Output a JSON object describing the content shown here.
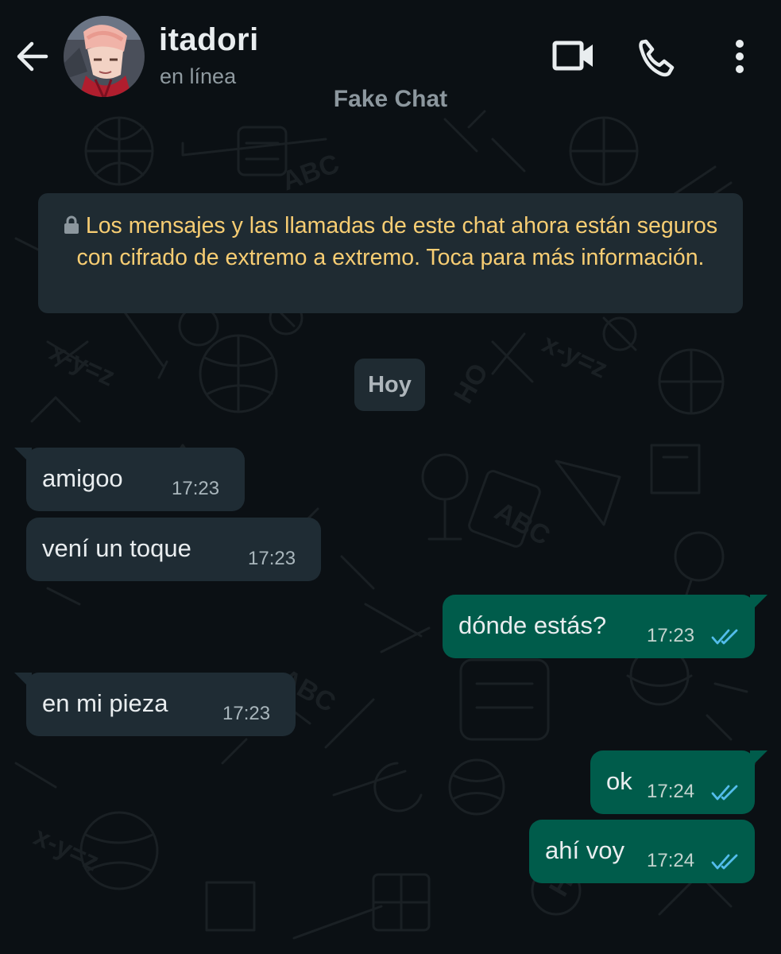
{
  "header": {
    "contact_name": "itadori",
    "status": "en línea",
    "watermark": "Fake Chat",
    "icons": {
      "back": "arrow-left-icon",
      "video": "video-camera-icon",
      "call": "phone-icon",
      "menu": "more-vertical-icon"
    }
  },
  "encryption_notice": {
    "text": "Los mensajes y las llamadas de este chat ahora están seguros con cifrado de extremo a extremo. Toca para más información.",
    "icon": "lock-icon"
  },
  "date_divider": "Hoy",
  "messages": [
    {
      "direction": "incoming",
      "text": "amigoo",
      "time": "17:23"
    },
    {
      "direction": "incoming",
      "text": "vení un toque",
      "time": "17:23"
    },
    {
      "direction": "outgoing",
      "text": "dónde estás?",
      "time": "17:23",
      "status": "read"
    },
    {
      "direction": "incoming",
      "text": "en mi pieza",
      "time": "17:23"
    },
    {
      "direction": "outgoing",
      "text": "ok",
      "time": "17:24",
      "status": "read"
    },
    {
      "direction": "outgoing",
      "text": "ahí voy",
      "time": "17:24",
      "status": "read"
    }
  ],
  "colors": {
    "background": "#0b1014",
    "incoming_bubble": "#1f2c34",
    "outgoing_bubble": "#005c4b",
    "notice_text": "#f7cd73",
    "read_tick": "#53bdeb"
  }
}
